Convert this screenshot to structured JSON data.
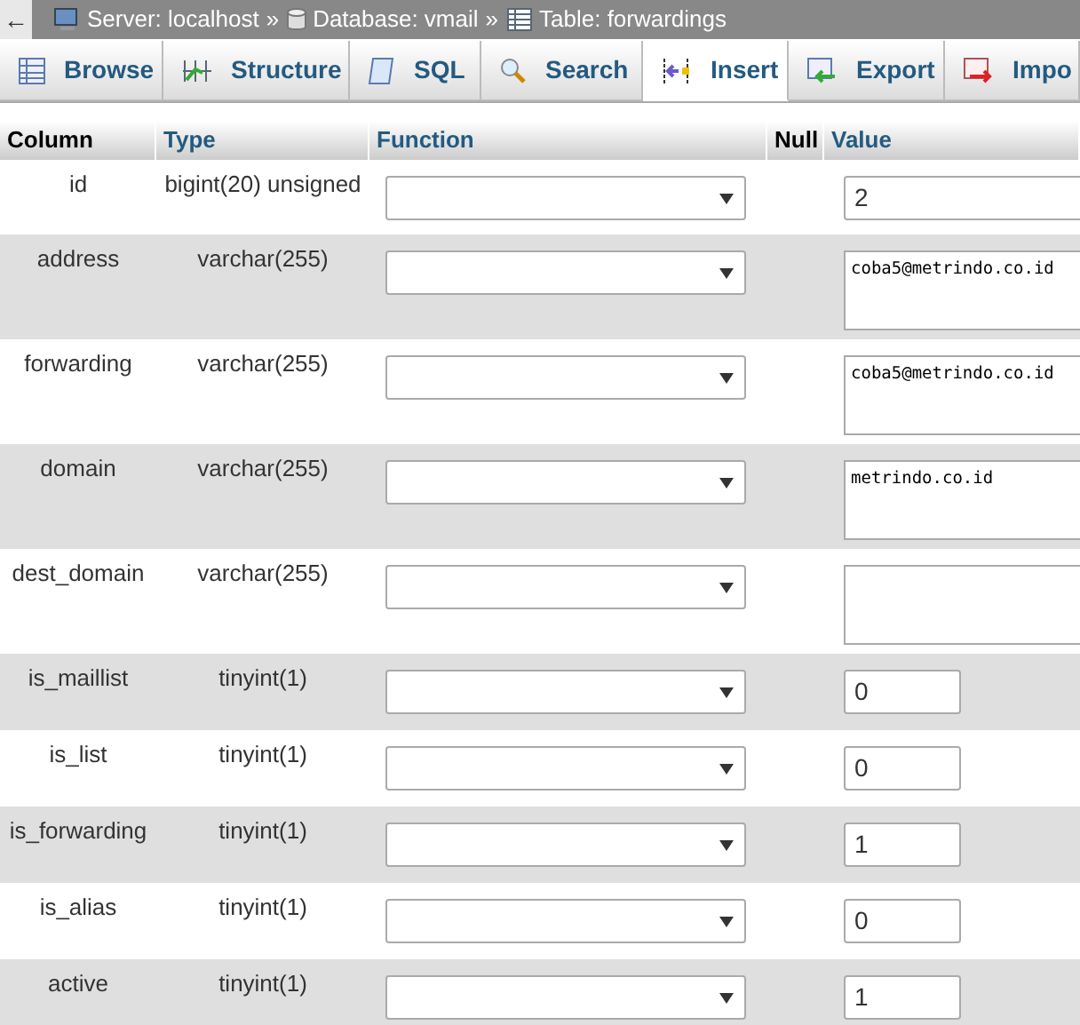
{
  "topbar": {
    "back": "←",
    "breadcrumb": [
      {
        "label": "Server: localhost",
        "sep": "»"
      },
      {
        "label": "Database: vmail",
        "sep": "»"
      },
      {
        "label": "Table: forwardings"
      }
    ]
  },
  "tabs": [
    {
      "label": "Browse",
      "selected": false
    },
    {
      "label": "Structure",
      "selected": false
    },
    {
      "label": "SQL",
      "selected": false
    },
    {
      "label": "Search",
      "selected": false
    },
    {
      "label": "Insert",
      "selected": true
    },
    {
      "label": "Export",
      "selected": false
    },
    {
      "label": "Impo",
      "selected": false
    }
  ],
  "table": {
    "columns": [
      "Column",
      "Type",
      "Function",
      "Null",
      "Value"
    ],
    "rows": [
      {
        "column": "id",
        "type": "bigint(20) unsigned",
        "kind": "wide",
        "value": "2"
      },
      {
        "column": "address",
        "type": "varchar(255)",
        "kind": "textarea",
        "value": "coba5@metrindo.co.id"
      },
      {
        "column": "forwarding",
        "type": "varchar(255)",
        "kind": "textarea",
        "value": "coba5@metrindo.co.id"
      },
      {
        "column": "domain",
        "type": "varchar(255)",
        "kind": "textarea",
        "value": "metrindo.co.id"
      },
      {
        "column": "dest_domain",
        "type": "varchar(255)",
        "kind": "textarea"
      },
      {
        "column": "is_maillist",
        "type": "tinyint(1)",
        "kind": "narrow",
        "value": "0"
      },
      {
        "column": "is_list",
        "type": "tinyint(1)",
        "kind": "narrow",
        "value": "0"
      },
      {
        "column": "is_forwarding",
        "type": "tinyint(1)",
        "kind": "narrow",
        "value": "1"
      },
      {
        "column": "is_alias",
        "type": "tinyint(1)",
        "kind": "narrow",
        "value": "0"
      },
      {
        "column": "active",
        "type": "tinyint(1)",
        "kind": "narrow",
        "value": "1"
      }
    ]
  }
}
